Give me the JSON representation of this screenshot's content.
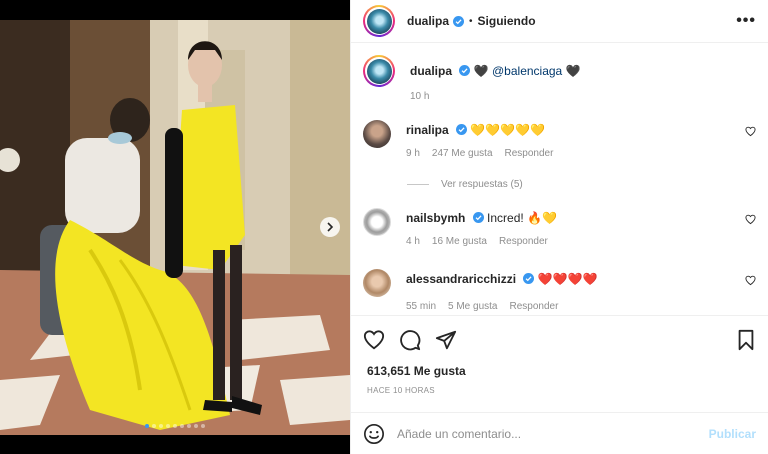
{
  "post": {
    "author": "dualipa",
    "status_separator": "•",
    "follow_label": "Siguiendo",
    "more_label": "•••",
    "carousel": {
      "slide_count": 9,
      "active_index": 0
    }
  },
  "caption": {
    "username": "dualipa",
    "emoji_1": "🖤",
    "mention": "@balenciaga",
    "emoji_2": "🖤",
    "time": "10 h"
  },
  "comments": [
    {
      "username": "rinalipa",
      "text": "💛💛💛💛💛",
      "time": "9 h",
      "likes": "247 Me gusta",
      "reply": "Responder",
      "view_replies": "Ver respuestas (5)"
    },
    {
      "username": "nailsbymh",
      "text": "Incred! ",
      "emoji": "🔥💛",
      "time": "4 h",
      "likes": "16 Me gusta",
      "reply": "Responder"
    },
    {
      "username": "alessandraricchizzi",
      "text": "❤️❤️❤️❤️",
      "time": "55 min",
      "likes": "5 Me gusta",
      "reply": "Responder"
    }
  ],
  "stats": {
    "likes": "613,651 Me gusta",
    "posted": "HACE 10 HORAS"
  },
  "composer": {
    "placeholder": "Añade un comentario...",
    "post_label": "Publicar"
  },
  "colors": {
    "verified": "#3897f0",
    "link": "#00376b",
    "post_disabled": "#b2dffc",
    "dress": "#f3e523"
  }
}
